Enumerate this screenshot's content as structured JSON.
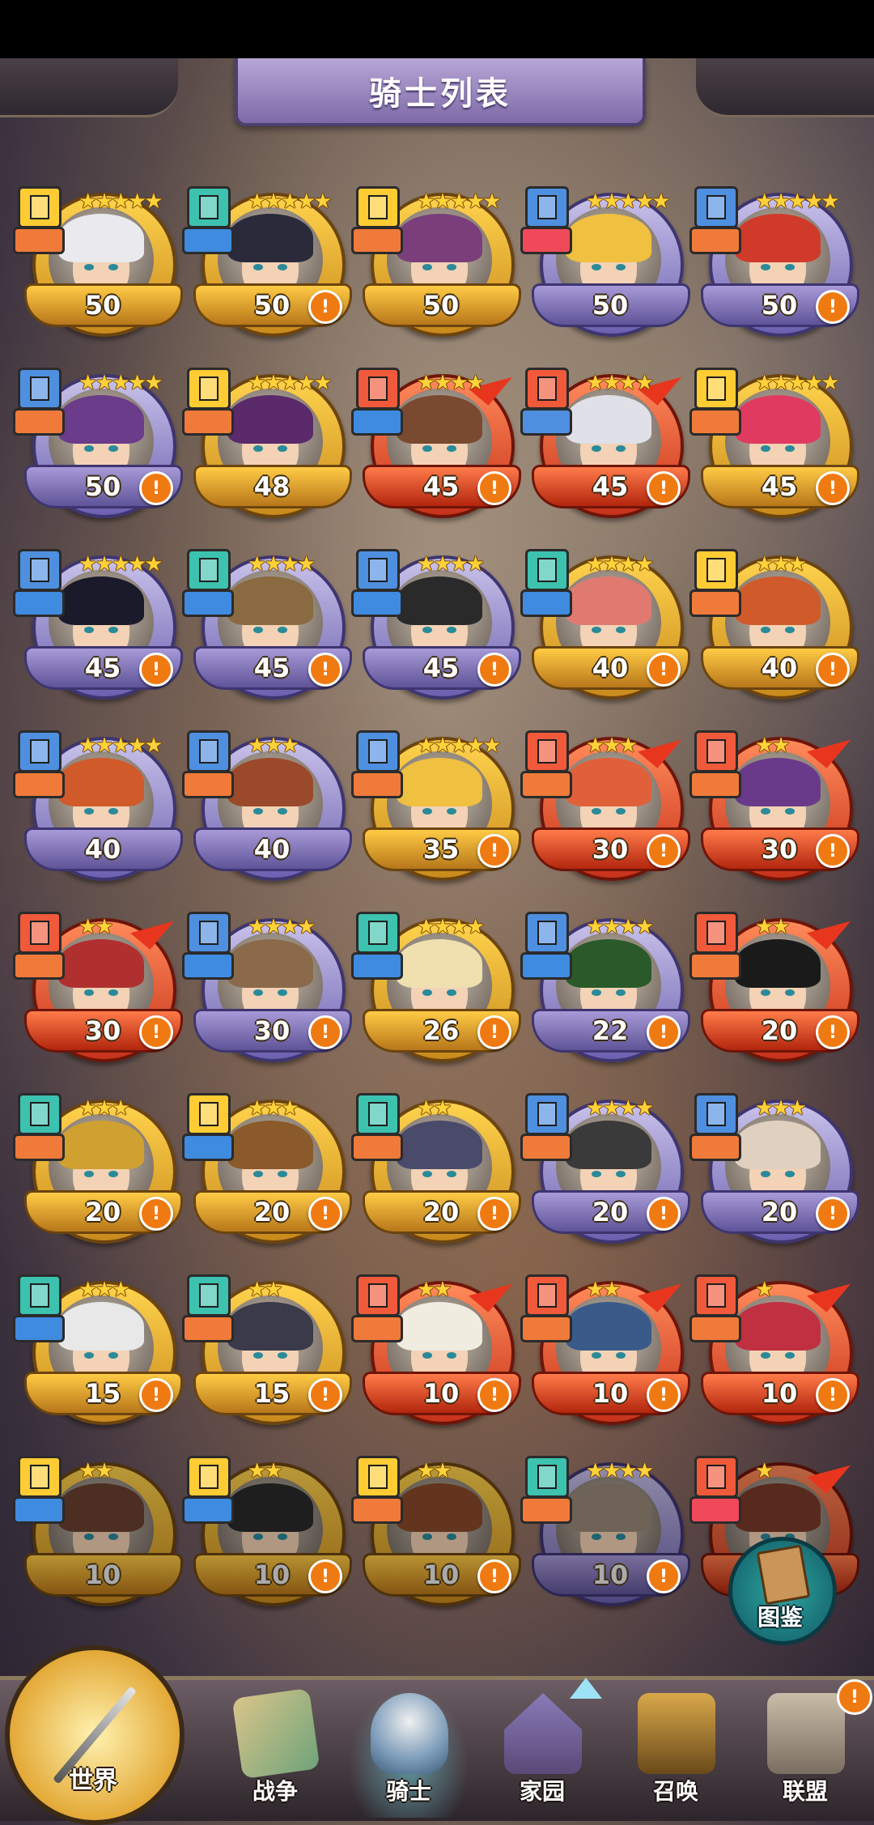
{
  "title": "骑士列表",
  "atlas_label": "图鉴",
  "nav": {
    "world": "世界",
    "items": [
      {
        "label": "战争",
        "active": false
      },
      {
        "label": "骑士",
        "active": true
      },
      {
        "label": "家园",
        "active": false
      },
      {
        "label": "召唤",
        "active": false
      },
      {
        "label": "联盟",
        "active": false
      }
    ],
    "alert": "!"
  },
  "alert_symbol": "!",
  "knights": [
    {
      "level": "50",
      "stars": 5,
      "frame": "gold",
      "alert": false,
      "class_color": "#ffcc33",
      "role_color": "#f07a3a",
      "hair": "#e9e9ee"
    },
    {
      "level": "50",
      "stars": 5,
      "frame": "gold",
      "alert": true,
      "class_color": "#3cc2ae",
      "role_color": "#3f8be0",
      "hair": "#2a2a3a"
    },
    {
      "level": "50",
      "stars": 5,
      "frame": "gold",
      "alert": false,
      "class_color": "#ffcc33",
      "role_color": "#f07a3a",
      "hair": "#7a3f7a"
    },
    {
      "level": "50",
      "stars": 5,
      "frame": "purple",
      "alert": false,
      "class_color": "#4f8fe0",
      "role_color": "#f04a5a",
      "hair": "#f0c040"
    },
    {
      "level": "50",
      "stars": 5,
      "frame": "purple",
      "alert": true,
      "class_color": "#4f8fe0",
      "role_color": "#f07a3a",
      "hair": "#d03a2a"
    },
    {
      "level": "50",
      "stars": 5,
      "frame": "purple",
      "alert": true,
      "class_color": "#4f8fe0",
      "role_color": "#f07a3a",
      "hair": "#6a3c8a"
    },
    {
      "level": "48",
      "stars": 5,
      "frame": "gold",
      "alert": false,
      "class_color": "#ffcc33",
      "role_color": "#f07a3a",
      "hair": "#5a2a6a"
    },
    {
      "level": "45",
      "stars": 4,
      "frame": "red",
      "alert": true,
      "class_color": "#f05a3a",
      "role_color": "#3f8be0",
      "hair": "#7a4a30"
    },
    {
      "level": "45",
      "stars": 4,
      "frame": "red",
      "alert": true,
      "class_color": "#f05a3a",
      "role_color": "#4f8fe0",
      "hair": "#e0e0e8"
    },
    {
      "level": "45",
      "stars": 5,
      "frame": "gold",
      "alert": true,
      "class_color": "#ffcc33",
      "role_color": "#f07a3a",
      "hair": "#e03a60"
    },
    {
      "level": "45",
      "stars": 5,
      "frame": "purple",
      "alert": true,
      "class_color": "#4f8fe0",
      "role_color": "#3f8be0",
      "hair": "#1a1a2a"
    },
    {
      "level": "45",
      "stars": 4,
      "frame": "purple",
      "alert": true,
      "class_color": "#3cc2ae",
      "role_color": "#3f8be0",
      "hair": "#8a6a40"
    },
    {
      "level": "45",
      "stars": 4,
      "frame": "purple",
      "alert": true,
      "class_color": "#4f8fe0",
      "role_color": "#3f8be0",
      "hair": "#2a2a2a"
    },
    {
      "level": "40",
      "stars": 4,
      "frame": "gold",
      "alert": true,
      "class_color": "#3cc2ae",
      "role_color": "#3f8be0",
      "hair": "#e07a70"
    },
    {
      "level": "40",
      "stars": 3,
      "frame": "gold",
      "alert": true,
      "class_color": "#ffcc33",
      "role_color": "#f07a3a",
      "hair": "#d05a2a"
    },
    {
      "level": "40",
      "stars": 5,
      "frame": "purple",
      "alert": false,
      "class_color": "#4f8fe0",
      "role_color": "#f07a3a",
      "hair": "#d05a2a"
    },
    {
      "level": "40",
      "stars": 3,
      "frame": "purple",
      "alert": false,
      "class_color": "#4f8fe0",
      "role_color": "#f07a3a",
      "hair": "#9a4a2a"
    },
    {
      "level": "35",
      "stars": 5,
      "frame": "gold",
      "alert": true,
      "class_color": "#4f8fe0",
      "role_color": "#f07a3a",
      "hair": "#f0c040"
    },
    {
      "level": "30",
      "stars": 3,
      "frame": "red",
      "alert": true,
      "class_color": "#f05a3a",
      "role_color": "#f07a3a",
      "hair": "#e0603a"
    },
    {
      "level": "30",
      "stars": 2,
      "frame": "red",
      "alert": true,
      "class_color": "#f05a3a",
      "role_color": "#f07a3a",
      "hair": "#6a3a8a"
    },
    {
      "level": "30",
      "stars": 2,
      "frame": "red",
      "alert": true,
      "class_color": "#f05a3a",
      "role_color": "#f07a3a",
      "hair": "#b03030"
    },
    {
      "level": "30",
      "stars": 4,
      "frame": "purple",
      "alert": true,
      "class_color": "#4f8fe0",
      "role_color": "#3f8be0",
      "hair": "#8a6a4a"
    },
    {
      "level": "26",
      "stars": 4,
      "frame": "gold",
      "alert": true,
      "class_color": "#3cc2ae",
      "role_color": "#3f8be0",
      "hair": "#f0e0b0"
    },
    {
      "level": "22",
      "stars": 4,
      "frame": "purple",
      "alert": true,
      "class_color": "#4f8fe0",
      "role_color": "#3f8be0",
      "hair": "#2a5a2a"
    },
    {
      "level": "20",
      "stars": 2,
      "frame": "red",
      "alert": true,
      "class_color": "#f05a3a",
      "role_color": "#f07a3a",
      "hair": "#1a1a1a"
    },
    {
      "level": "20",
      "stars": 3,
      "frame": "gold",
      "alert": true,
      "class_color": "#3cc2ae",
      "role_color": "#f07a3a",
      "hair": "#d0a030"
    },
    {
      "level": "20",
      "stars": 3,
      "frame": "gold",
      "alert": true,
      "class_color": "#ffcc33",
      "role_color": "#3f8be0",
      "hair": "#8a5a2a"
    },
    {
      "level": "20",
      "stars": 2,
      "frame": "gold",
      "alert": true,
      "class_color": "#3cc2ae",
      "role_color": "#f07a3a",
      "hair": "#4a4a6a"
    },
    {
      "level": "20",
      "stars": 4,
      "frame": "purple",
      "alert": true,
      "class_color": "#4f8fe0",
      "role_color": "#f07a3a",
      "hair": "#3a3a3a"
    },
    {
      "level": "20",
      "stars": 3,
      "frame": "purple",
      "alert": true,
      "class_color": "#4f8fe0",
      "role_color": "#f07a3a",
      "hair": "#e0d0c0"
    },
    {
      "level": "15",
      "stars": 3,
      "frame": "gold",
      "alert": true,
      "class_color": "#3cc2ae",
      "role_color": "#3f8be0",
      "hair": "#e8e8e8"
    },
    {
      "level": "15",
      "stars": 2,
      "frame": "gold",
      "alert": true,
      "class_color": "#3cc2ae",
      "role_color": "#f07a3a",
      "hair": "#3a3a4a"
    },
    {
      "level": "10",
      "stars": 2,
      "frame": "red",
      "alert": true,
      "class_color": "#f05a3a",
      "role_color": "#f07a3a",
      "hair": "#f0ece0"
    },
    {
      "level": "10",
      "stars": 2,
      "frame": "red",
      "alert": true,
      "class_color": "#f05a3a",
      "role_color": "#f07a3a",
      "hair": "#3a5a8a"
    },
    {
      "level": "10",
      "stars": 1,
      "frame": "red",
      "alert": true,
      "class_color": "#f05a3a",
      "role_color": "#f07a3a",
      "hair": "#c03040"
    },
    {
      "level": "10",
      "stars": 2,
      "frame": "gold",
      "alert": false,
      "class_color": "#ffcc33",
      "role_color": "#3f8be0",
      "hair": "#6a4030",
      "dim": true
    },
    {
      "level": "10",
      "stars": 2,
      "frame": "gold",
      "alert": true,
      "class_color": "#ffcc33",
      "role_color": "#3f8be0",
      "hair": "#2a2a2a",
      "dim": true
    },
    {
      "level": "10",
      "stars": 2,
      "frame": "gold",
      "alert": true,
      "class_color": "#ffcc33",
      "role_color": "#f07a3a",
      "hair": "#8a4a2a",
      "dim": true
    },
    {
      "level": "10",
      "stars": 4,
      "frame": "purple",
      "alert": true,
      "class_color": "#3cc2ae",
      "role_color": "#f07a3a",
      "hair": "#9a8a7a",
      "dim": true
    },
    {
      "level": "",
      "stars": 1,
      "frame": "red",
      "alert": false,
      "class_color": "#f05a3a",
      "role_color": "#f04a5a",
      "hair": "#7a3a2a",
      "dim": true
    }
  ]
}
